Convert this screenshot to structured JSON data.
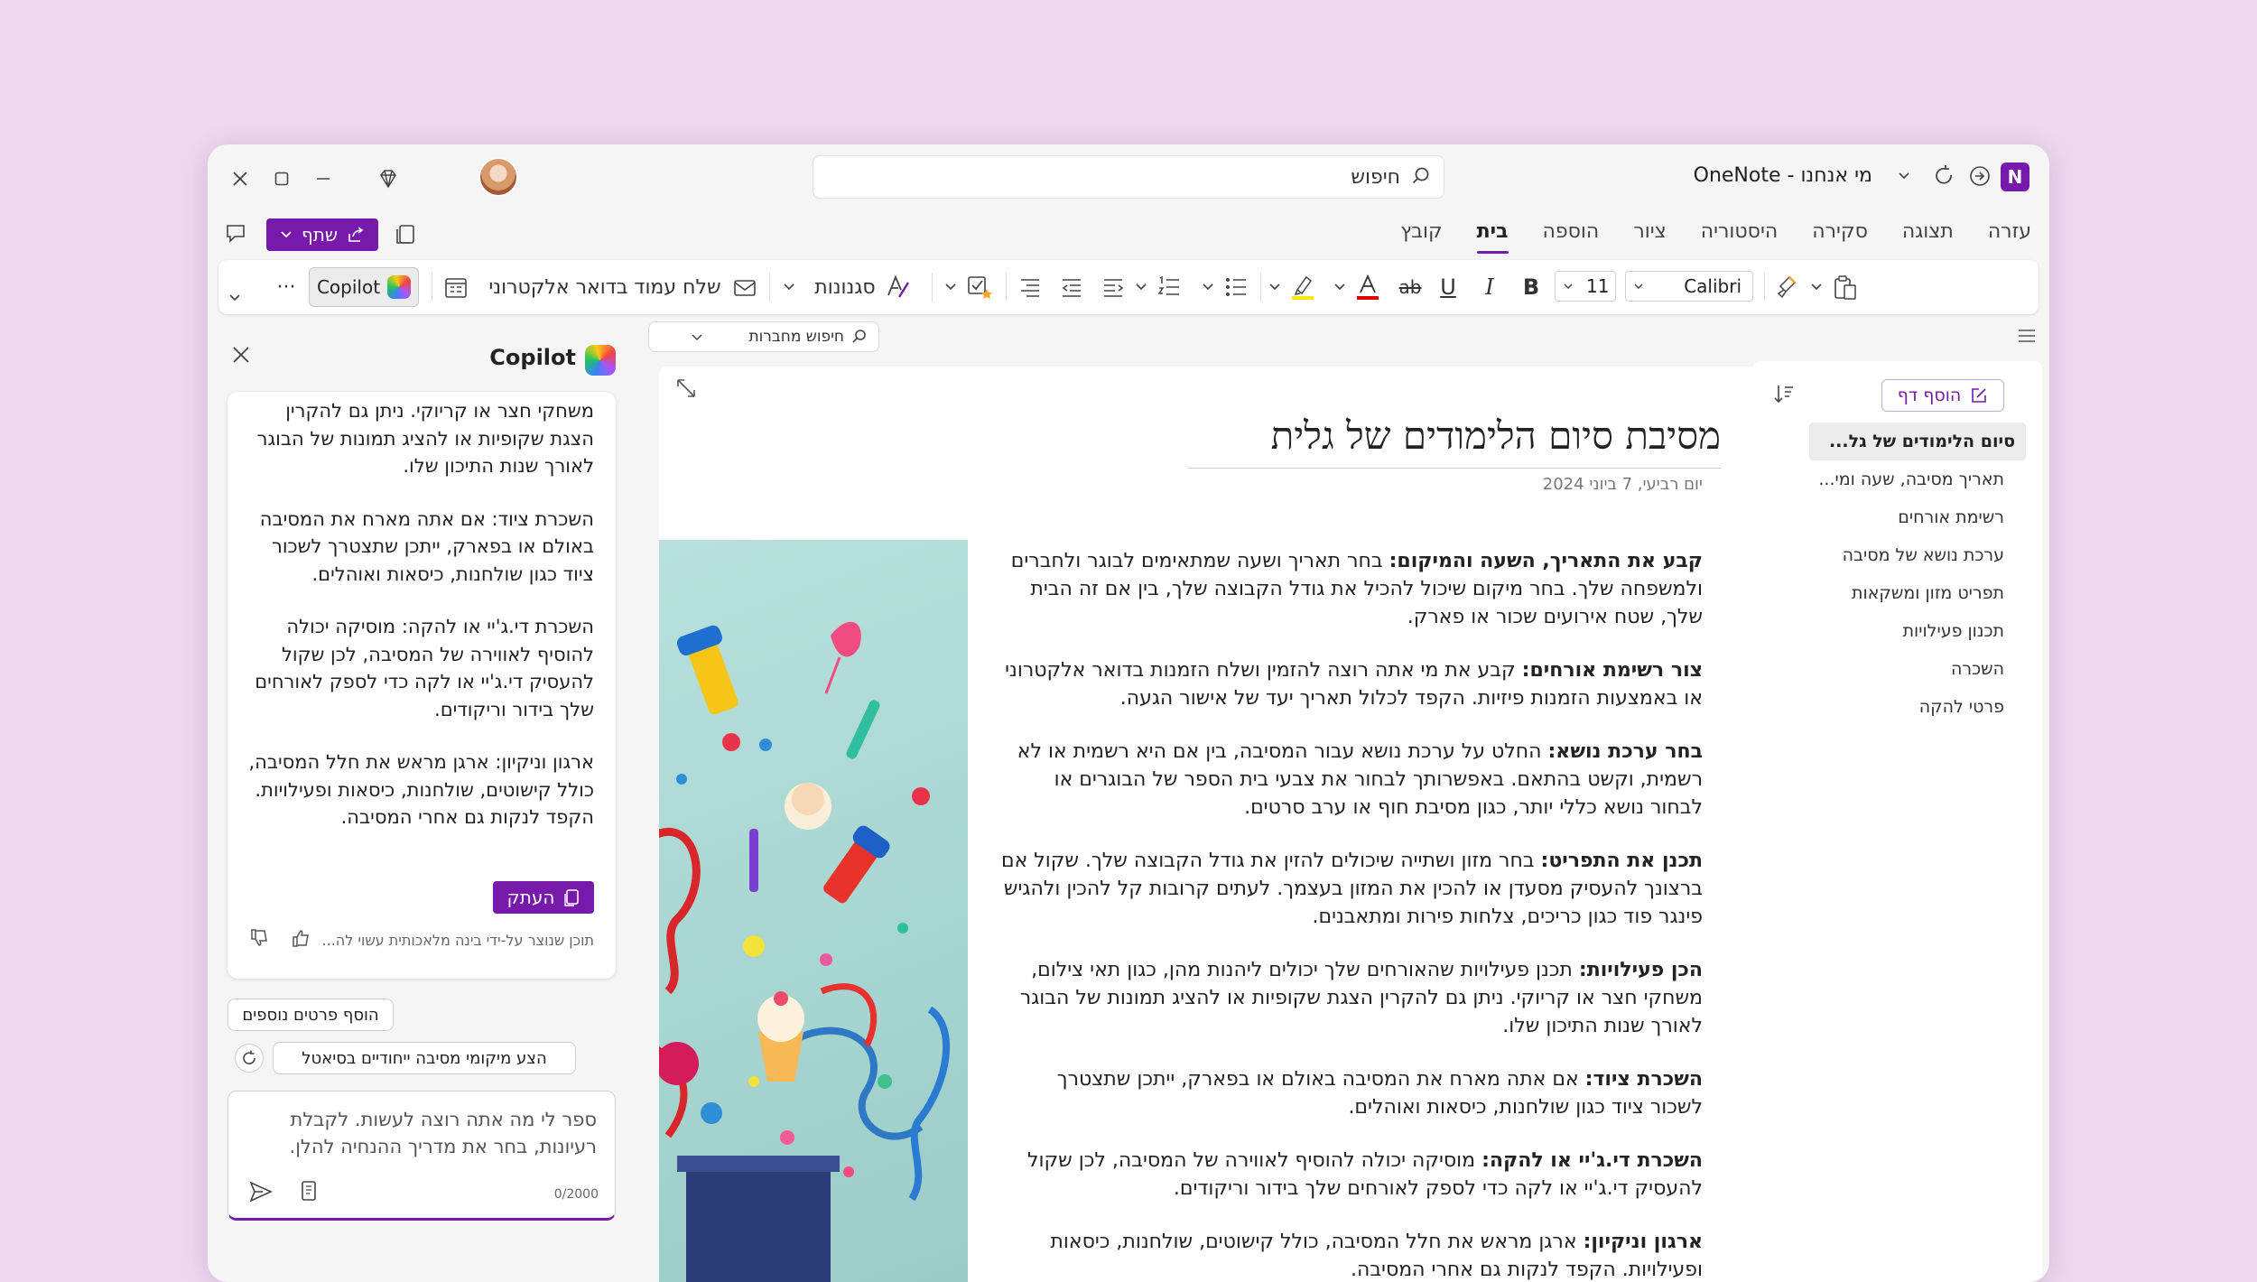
{
  "titlebar": {
    "app_title": "מי אנחנו - OneNote",
    "search_placeholder": "חיפוש"
  },
  "ribbon_tabs": [
    "קובץ",
    "בית",
    "הוספה",
    "ציור",
    "היסטוריה",
    "סקירה",
    "תצוגה",
    "עזרה"
  ],
  "share_label": "שתף",
  "ribbon": {
    "font_name": "Calibri",
    "font_size": "11",
    "bold": "B",
    "italic": "I",
    "underline": "U",
    "strike": "ab",
    "styles_label": "סגנונות",
    "email_page_label": "שלח עמוד בדואר אלקטרוני",
    "copilot_label": "Copilot",
    "more_label": "···"
  },
  "notebook_search": "חיפוש מחברות",
  "copilot": {
    "title": "Copilot",
    "response_paragraphs": [
      "משחקי חצר או קריוקי. ניתן גם להקרין הצגת שקופיות או להציג תמונות של הבוגר לאורך שנות התיכון שלו.",
      "השכרת ציוד: אם אתה מארח את המסיבה באולם או בפארק, ייתכן שתצטרך לשכור ציוד כגון שולחנות, כיסאות ואוהלים.",
      "השכרת די.ג'יי או להקה: מוסיקה יכולה להוסיף לאווירה של המסיבה, לכן שקול להעסיק די.ג'יי או לקה כדי לספק לאורחים שלך בידור וריקודים.",
      "ארגון וניקיון: ארגן מראש את חלל המסיבה, כולל קישוטים, שולחנות, כיסאות ופעילויות. הקפד לנקות גם אחרי המסיבה."
    ],
    "copy_label": "העתק",
    "ai_disclaimer": "תוכן שנוצר על-ידי בינה מלאכותית עשוי לה...",
    "suggestions": [
      "הוסף פרטים נוספים",
      "הצע מיקומי מסיבה ייחודיים בסיאטל"
    ],
    "input_placeholder": "ספר לי מה אתה רוצה לעשות. לקבלת רעיונות, בחר את מדריך ההנחיה להלן.",
    "counter": "0/2000"
  },
  "page": {
    "title": "מסיבת סיום הלימודים של גלית",
    "date": "יום רביעי, 7 ביוני 2024",
    "paragraphs": [
      {
        "head": "קבע את התאריך, השעה והמיקום:",
        "text": " בחר תאריך ושעה שמתאימים לבוגר ולחברים ולמשפחה שלך. בחר מיקום שיכול להכיל את גודל הקבוצה שלך, בין אם זה הבית שלך, שטח אירועים שכור או פארק."
      },
      {
        "head": "צור רשימת אורחים:",
        "text": " קבע את מי אתה רוצה להזמין ושלח הזמנות בדואר אלקטרוני או באמצעות הזמנות פיזיות. הקפד לכלול תאריך יעד של אישור הגעה."
      },
      {
        "head": "בחר ערכת נושא:",
        "text": " החלט על ערכת נושא עבור המסיבה, בין אם היא רשמית או לא רשמית, וקשט בהתאם. באפשרותך לבחור את צבעי בית הספר של הבוגרים או לבחור נושא כללי יותר, כגון מסיבת חוף או ערב סרטים."
      },
      {
        "head": "תכנן את התפריט:",
        "text": " בחר מזון ושתייה שיכולים להזין את גודל הקבוצה שלך. שקול אם ברצונך להעסיק מסעדן או להכין את המזון בעצמך. לעתים קרובות קל להכין ולהגיש פינגר פוד כגון כריכים, צלחות פירות ומתאבנים."
      },
      {
        "head": "הכן פעילויות:",
        "text": " תכנן פעילויות שהאורחים שלך יכולים ליהנות מהן, כגון תאי צילום, משחקי חצר או קריוקי. ניתן גם להקרין הצגת שקופיות או להציג תמונות של הבוגר לאורך שנות התיכון שלו."
      },
      {
        "head": "השכרת ציוד:",
        "text": " אם אתה מארח את המסיבה באולם או בפארק, ייתכן שתצטרך לשכור ציוד כגון שולחנות, כיסאות ואוהלים."
      },
      {
        "head": "השכרת די.ג'יי או להקה:",
        "text": " מוסיקה יכולה להוסיף לאווירה של המסיבה, לכן שקול להעסיק די.ג'יי או לקה כדי לספק לאורחים שלך בידור וריקודים."
      },
      {
        "head": "ארגון וניקיון:",
        "text": " ארגן מראש את חלל המסיבה, כולל קישוטים, שולחנות, כיסאות ופעילויות. הקפד לנקות גם אחרי המסיבה."
      }
    ]
  },
  "pages_pane": {
    "add_page_label": "הוסף דף",
    "items": [
      "סיום הלימודים של גל...",
      "תאריך מסיבה, שעה ומי...",
      "רשימת אורחים",
      "ערכת נושא של מסיבה",
      "תפריט מזון ומשקאות",
      "תכנון פעילויות",
      "השכרה",
      "פרטי להקה"
    ],
    "active_index": 0
  },
  "colors": {
    "accent": "#7719aa",
    "background": "#eed8ef",
    "font_color_bar": "#e00000",
    "highlight_bar": "#ffe600"
  }
}
